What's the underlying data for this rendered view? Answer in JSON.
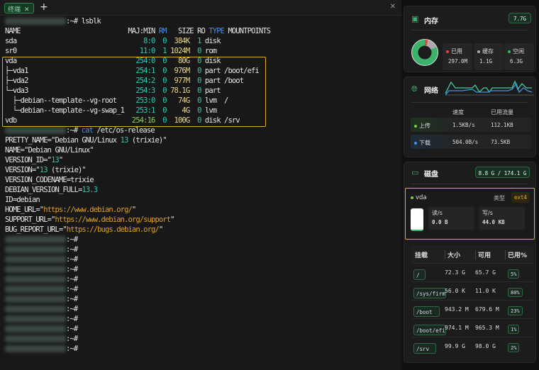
{
  "tabs": {
    "active": "终端",
    "close": "✕",
    "add": "+",
    "window_close": "✕"
  },
  "terminal": {
    "prompt_suffix": ":~#",
    "cmd1": "lsblk",
    "lsblk": {
      "header": [
        "NAME",
        "MAJ:MIN",
        "RM",
        "SIZE",
        "RO",
        "TYPE",
        "MOUNTPOINTS"
      ],
      "rows": [
        {
          "name": "sda",
          "majmin": "8:0",
          "rm": "0",
          "size": "384K",
          "ro": "1",
          "type": "disk",
          "mount": ""
        },
        {
          "name": "sr0",
          "majmin": "11:0",
          "rm": "1",
          "size": "1024M",
          "ro": "0",
          "type": "rom",
          "mount": ""
        },
        {
          "name": "vda",
          "majmin": "254:0",
          "rm": "0",
          "size": "80G",
          "ro": "0",
          "type": "disk",
          "mount": ""
        },
        {
          "name": "├─vda1",
          "majmin": "254:1",
          "rm": "0",
          "size": "976M",
          "ro": "0",
          "type": "part",
          "mount": "/boot/efi"
        },
        {
          "name": "├─vda2",
          "majmin": "254:2",
          "rm": "0",
          "size": "977M",
          "ro": "0",
          "type": "part",
          "mount": "/boot"
        },
        {
          "name": "└─vda3",
          "majmin": "254:3",
          "rm": "0",
          "size": "78.1G",
          "ro": "0",
          "type": "part",
          "mount": ""
        },
        {
          "name": "  ├─debian--template--vg-root",
          "majmin": "253:0",
          "rm": "0",
          "size": "74G",
          "ro": "0",
          "type": "lvm",
          "mount": " /"
        },
        {
          "name": "  └─debian--template--vg-swap_1",
          "majmin": "253:1",
          "rm": "0",
          "size": "4G",
          "ro": "0",
          "type": "lvm",
          "mount": ""
        },
        {
          "name": "vdb",
          "majmin": "254:16",
          "rm": "0",
          "size": "100G",
          "ro": "0",
          "type": "disk",
          "mount": "/srv"
        }
      ]
    },
    "cmd2": [
      "cat",
      " /etc/os-release"
    ],
    "os_release": [
      [
        [
          "PRETTY_NAME=\"Debian GNU/Linux ",
          ""
        ],
        [
          "13",
          "teal"
        ],
        [
          " (trixie)\"",
          ""
        ]
      ],
      [
        [
          "NAME=\"Debian GNU/Linux\"",
          ""
        ]
      ],
      [
        [
          "VERSION_ID=\"",
          ""
        ],
        [
          "13",
          "teal"
        ],
        [
          "\"",
          ""
        ]
      ],
      [
        [
          "VERSION=\"",
          ""
        ],
        [
          "13",
          "teal"
        ],
        [
          " (trixie)\"",
          ""
        ]
      ],
      [
        [
          "VERSION_CODENAME=trixie",
          ""
        ]
      ],
      [
        [
          "DEBIAN_VERSION_FULL=",
          ""
        ],
        [
          "13.3",
          "teal"
        ]
      ],
      [
        [
          "ID=debian",
          ""
        ]
      ],
      [
        [
          "HOME_URL=\"",
          ""
        ],
        [
          "https://www.debian.org/",
          "orng"
        ],
        [
          "\"",
          ""
        ]
      ],
      [
        [
          "SUPPORT_URL=\"",
          ""
        ],
        [
          "https://www.debian.org/support",
          "orng"
        ],
        [
          "\"",
          ""
        ]
      ],
      [
        [
          "BUG_REPORT_URL=\"",
          ""
        ],
        [
          "https://bugs.debian.org/",
          "orng"
        ],
        [
          "\"",
          ""
        ]
      ]
    ],
    "empty_prompts": 12
  },
  "memory": {
    "title": "内存",
    "total": "7.7G",
    "used_fraction": 0.04,
    "cache_fraction": 0.14,
    "items": [
      {
        "label": "已用",
        "value": "297.0M",
        "color": "#e0483c"
      },
      {
        "label": "缓存",
        "value": "1.1G",
        "color": "#aaaaaa"
      },
      {
        "label": "空闲",
        "value": "6.3G",
        "color": "#3bb36a"
      }
    ]
  },
  "network": {
    "title": "网络",
    "col_speed": "速度",
    "col_traffic": "已用流量",
    "rows": [
      {
        "label": "上传",
        "speed": "1.5KB/s",
        "traffic": "112.1KB",
        "color": "#7ed03a"
      },
      {
        "label": "下载",
        "speed": "504.0B/s",
        "traffic": "73.5KB",
        "color": "#4a8fe0"
      }
    ]
  },
  "disk": {
    "title": "磁盘",
    "total": "8.8 G / 174.1 G",
    "device": {
      "name": "vda",
      "type_label": "类型",
      "type": "ext4",
      "read_label": "读/s",
      "read": "0.0 B",
      "write_label": "写/s",
      "write": "44.0 KB"
    },
    "columns": [
      "挂载",
      "大小",
      "可用",
      "已用%"
    ],
    "rows": [
      {
        "mount": "/",
        "size": "72.3 G",
        "avail": "65.7 G",
        "pct": "5%"
      },
      {
        "mount": "/sys/firmware/efi/efivars",
        "size": "56.0 K",
        "avail": "11.0 K",
        "pct": "80%"
      },
      {
        "mount": "/boot",
        "size": "943.2 M",
        "avail": "679.6 M",
        "pct": "23%"
      },
      {
        "mount": "/boot/efi",
        "size": "974.1 M",
        "avail": "965.3 M",
        "pct": "1%"
      },
      {
        "mount": "/srv",
        "size": "99.9 G",
        "avail": "98.0 G",
        "pct": "2%"
      }
    ]
  }
}
